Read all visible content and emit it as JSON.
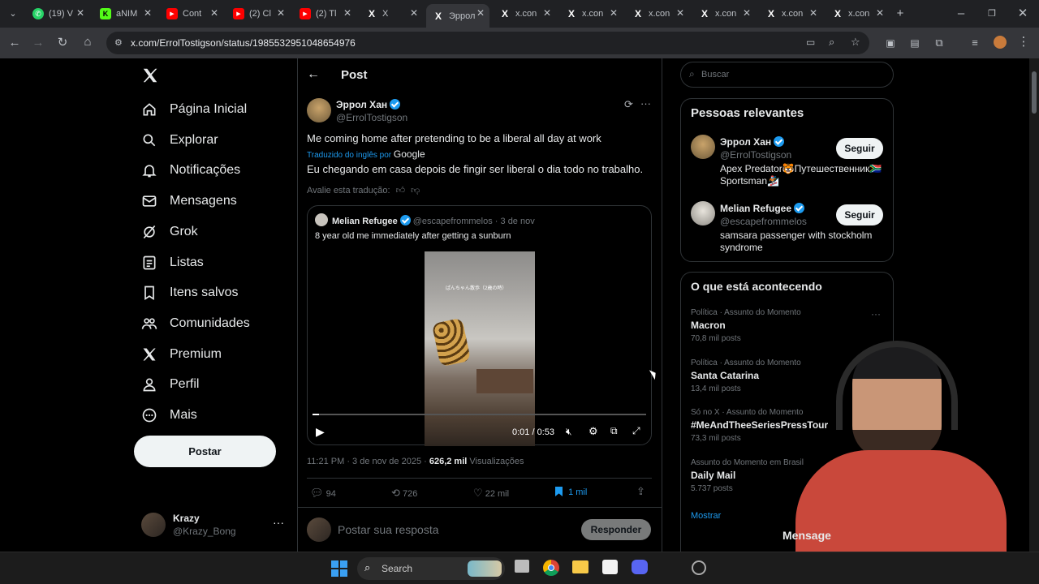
{
  "browser": {
    "tabs": [
      {
        "label": "(19) V",
        "icon": "whatsapp-icon",
        "color": "#25d366"
      },
      {
        "label": "aNIM",
        "icon": "k-icon",
        "color": "#53fc18"
      },
      {
        "label": "Cont",
        "icon": "youtube-icon",
        "color": "#ff0000"
      },
      {
        "label": "(2) Cl",
        "icon": "youtube-icon",
        "color": "#ff0000"
      },
      {
        "label": "(2) Tl",
        "icon": "youtube-icon",
        "color": "#ff0000"
      },
      {
        "label": "X",
        "icon": "x-icon",
        "color": "#000000"
      },
      {
        "label": "Эррол",
        "icon": "x-icon",
        "color": "#000000",
        "active": true
      },
      {
        "label": "x.con",
        "icon": "x-icon",
        "color": "#000000"
      },
      {
        "label": "x.con",
        "icon": "x-icon",
        "color": "#000000"
      },
      {
        "label": "x.con",
        "icon": "x-icon",
        "color": "#000000"
      },
      {
        "label": "x.con",
        "icon": "x-icon",
        "color": "#000000"
      },
      {
        "label": "x.con",
        "icon": "x-icon",
        "color": "#000000"
      },
      {
        "label": "x.con",
        "icon": "x-icon",
        "color": "#000000"
      }
    ],
    "url": "x.com/ErrolTostigson/status/1985532951048654976"
  },
  "nav": {
    "items": [
      {
        "label": "Página Inicial",
        "icon": "home-icon"
      },
      {
        "label": "Explorar",
        "icon": "search-icon"
      },
      {
        "label": "Notificações",
        "icon": "bell-icon"
      },
      {
        "label": "Mensagens",
        "icon": "mail-icon"
      },
      {
        "label": "Grok",
        "icon": "grok-icon"
      },
      {
        "label": "Listas",
        "icon": "list-icon"
      },
      {
        "label": "Itens salvos",
        "icon": "bookmark-icon"
      },
      {
        "label": "Comunidades",
        "icon": "communities-icon"
      },
      {
        "label": "Premium",
        "icon": "x-icon"
      },
      {
        "label": "Perfil",
        "icon": "person-icon"
      },
      {
        "label": "Mais",
        "icon": "more-circle-icon"
      }
    ],
    "post_label": "Postar",
    "account": {
      "name": "Krazy",
      "handle": "@Krazy_Bong"
    }
  },
  "post": {
    "header_title": "Post",
    "author_name": "Эррол Хан",
    "author_handle": "@ErrolTostigson",
    "text": "Me coming home after pretending to be a liberal all day at work",
    "translated_from": "Traduzido do inglês por",
    "translator": "Google",
    "translation": "Eu chegando em casa depois de fingir ser liberal o dia todo no trabalho.",
    "rate_translation": "Avalie esta tradução:",
    "quote": {
      "author_name": "Melian Refugee",
      "author_handle": "@escapefrommelos",
      "date": "· 3 de nov",
      "text": "8 year old me immediately after getting a sunburn",
      "video_caption": "ぱんちゃん散歩（2歳の時）",
      "video_time": "0:01 / 0:53",
      "progress": 0.02
    },
    "timestamp": "11:21 PM · 3 de nov de 2025 ·",
    "views": "626,2 mil",
    "views_label": "Visualizações",
    "replies": "94",
    "reposts": "726",
    "likes": "22 mil",
    "bookmarks": "1 mil",
    "reply_placeholder": "Postar sua resposta",
    "reply_button": "Responder"
  },
  "sidebar": {
    "search_placeholder": "Buscar",
    "relevant_title": "Pessoas relevantes",
    "people": [
      {
        "name": "Эррол Хан",
        "handle": "@ErrolTostigson",
        "bio": "Apex Predator🐯Путешественник🇿🇦 Sportsman🏂",
        "follow": "Seguir"
      },
      {
        "name": "Melian Refugee",
        "handle": "@escapefrommelos",
        "bio": "samsara passenger with stockholm syndrome",
        "follow": "Seguir"
      }
    ],
    "trending_title": "O que está acontecendo",
    "trends": [
      {
        "meta": "Política · Assunto do Momento",
        "name": "Macron",
        "count": "70,8 mil posts"
      },
      {
        "meta": "Política · Assunto do Momento",
        "name": "Santa Catarina",
        "count": "13,4 mil posts"
      },
      {
        "meta": "Só no X · Assunto do Momento",
        "name": "#MeAndTheeSeriesPressTour",
        "count": "73,3 mil posts"
      },
      {
        "meta": "Assunto do Momento em Brasil",
        "name": "Daily Mail",
        "count": "5.737 posts"
      }
    ],
    "show_more": "Mostrar",
    "messages_drawer": "Mensage"
  },
  "taskbar": {
    "search_label": "Search"
  }
}
